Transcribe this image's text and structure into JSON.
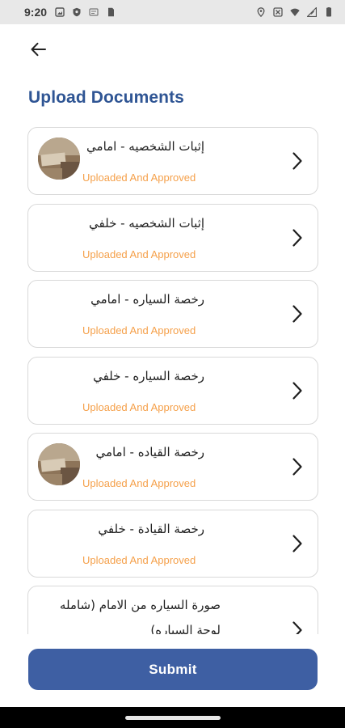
{
  "status_bar": {
    "time": "9:20",
    "left_icons": [
      "photo-icon",
      "shield-icon",
      "notification-icon",
      "sim-card-icon"
    ],
    "right_icons": [
      "location-icon",
      "no-sim-icon",
      "wifi-icon",
      "signal-icon",
      "battery-icon"
    ]
  },
  "header": {
    "title": "Upload Documents"
  },
  "documents": [
    {
      "name": "إثبات الشخصيه - امامي",
      "status": "Uploaded And Approved",
      "has_thumbnail": true
    },
    {
      "name": "إثبات الشخصيه - خلفي",
      "status": "Uploaded And Approved",
      "has_thumbnail": false
    },
    {
      "name": "رخصة السياره - امامي",
      "status": "Uploaded And Approved",
      "has_thumbnail": false
    },
    {
      "name": "رخصة السياره - خلفي",
      "status": "Uploaded And Approved",
      "has_thumbnail": false
    },
    {
      "name": "رخصة القياده - امامي",
      "status": "Uploaded And Approved",
      "has_thumbnail": true
    },
    {
      "name": "رخصة القيادة - خلفي",
      "status": "Uploaded And Approved",
      "has_thumbnail": false
    },
    {
      "name": "صورة السياره من الامام (شامله لوحة السياره)",
      "status": "",
      "has_thumbnail": false
    }
  ],
  "submit_label": "Submit",
  "colors": {
    "title": "#2f5594",
    "status_text": "#f5a04a",
    "submit_bg": "#3e5fa3",
    "card_border": "#d9d9d9"
  }
}
